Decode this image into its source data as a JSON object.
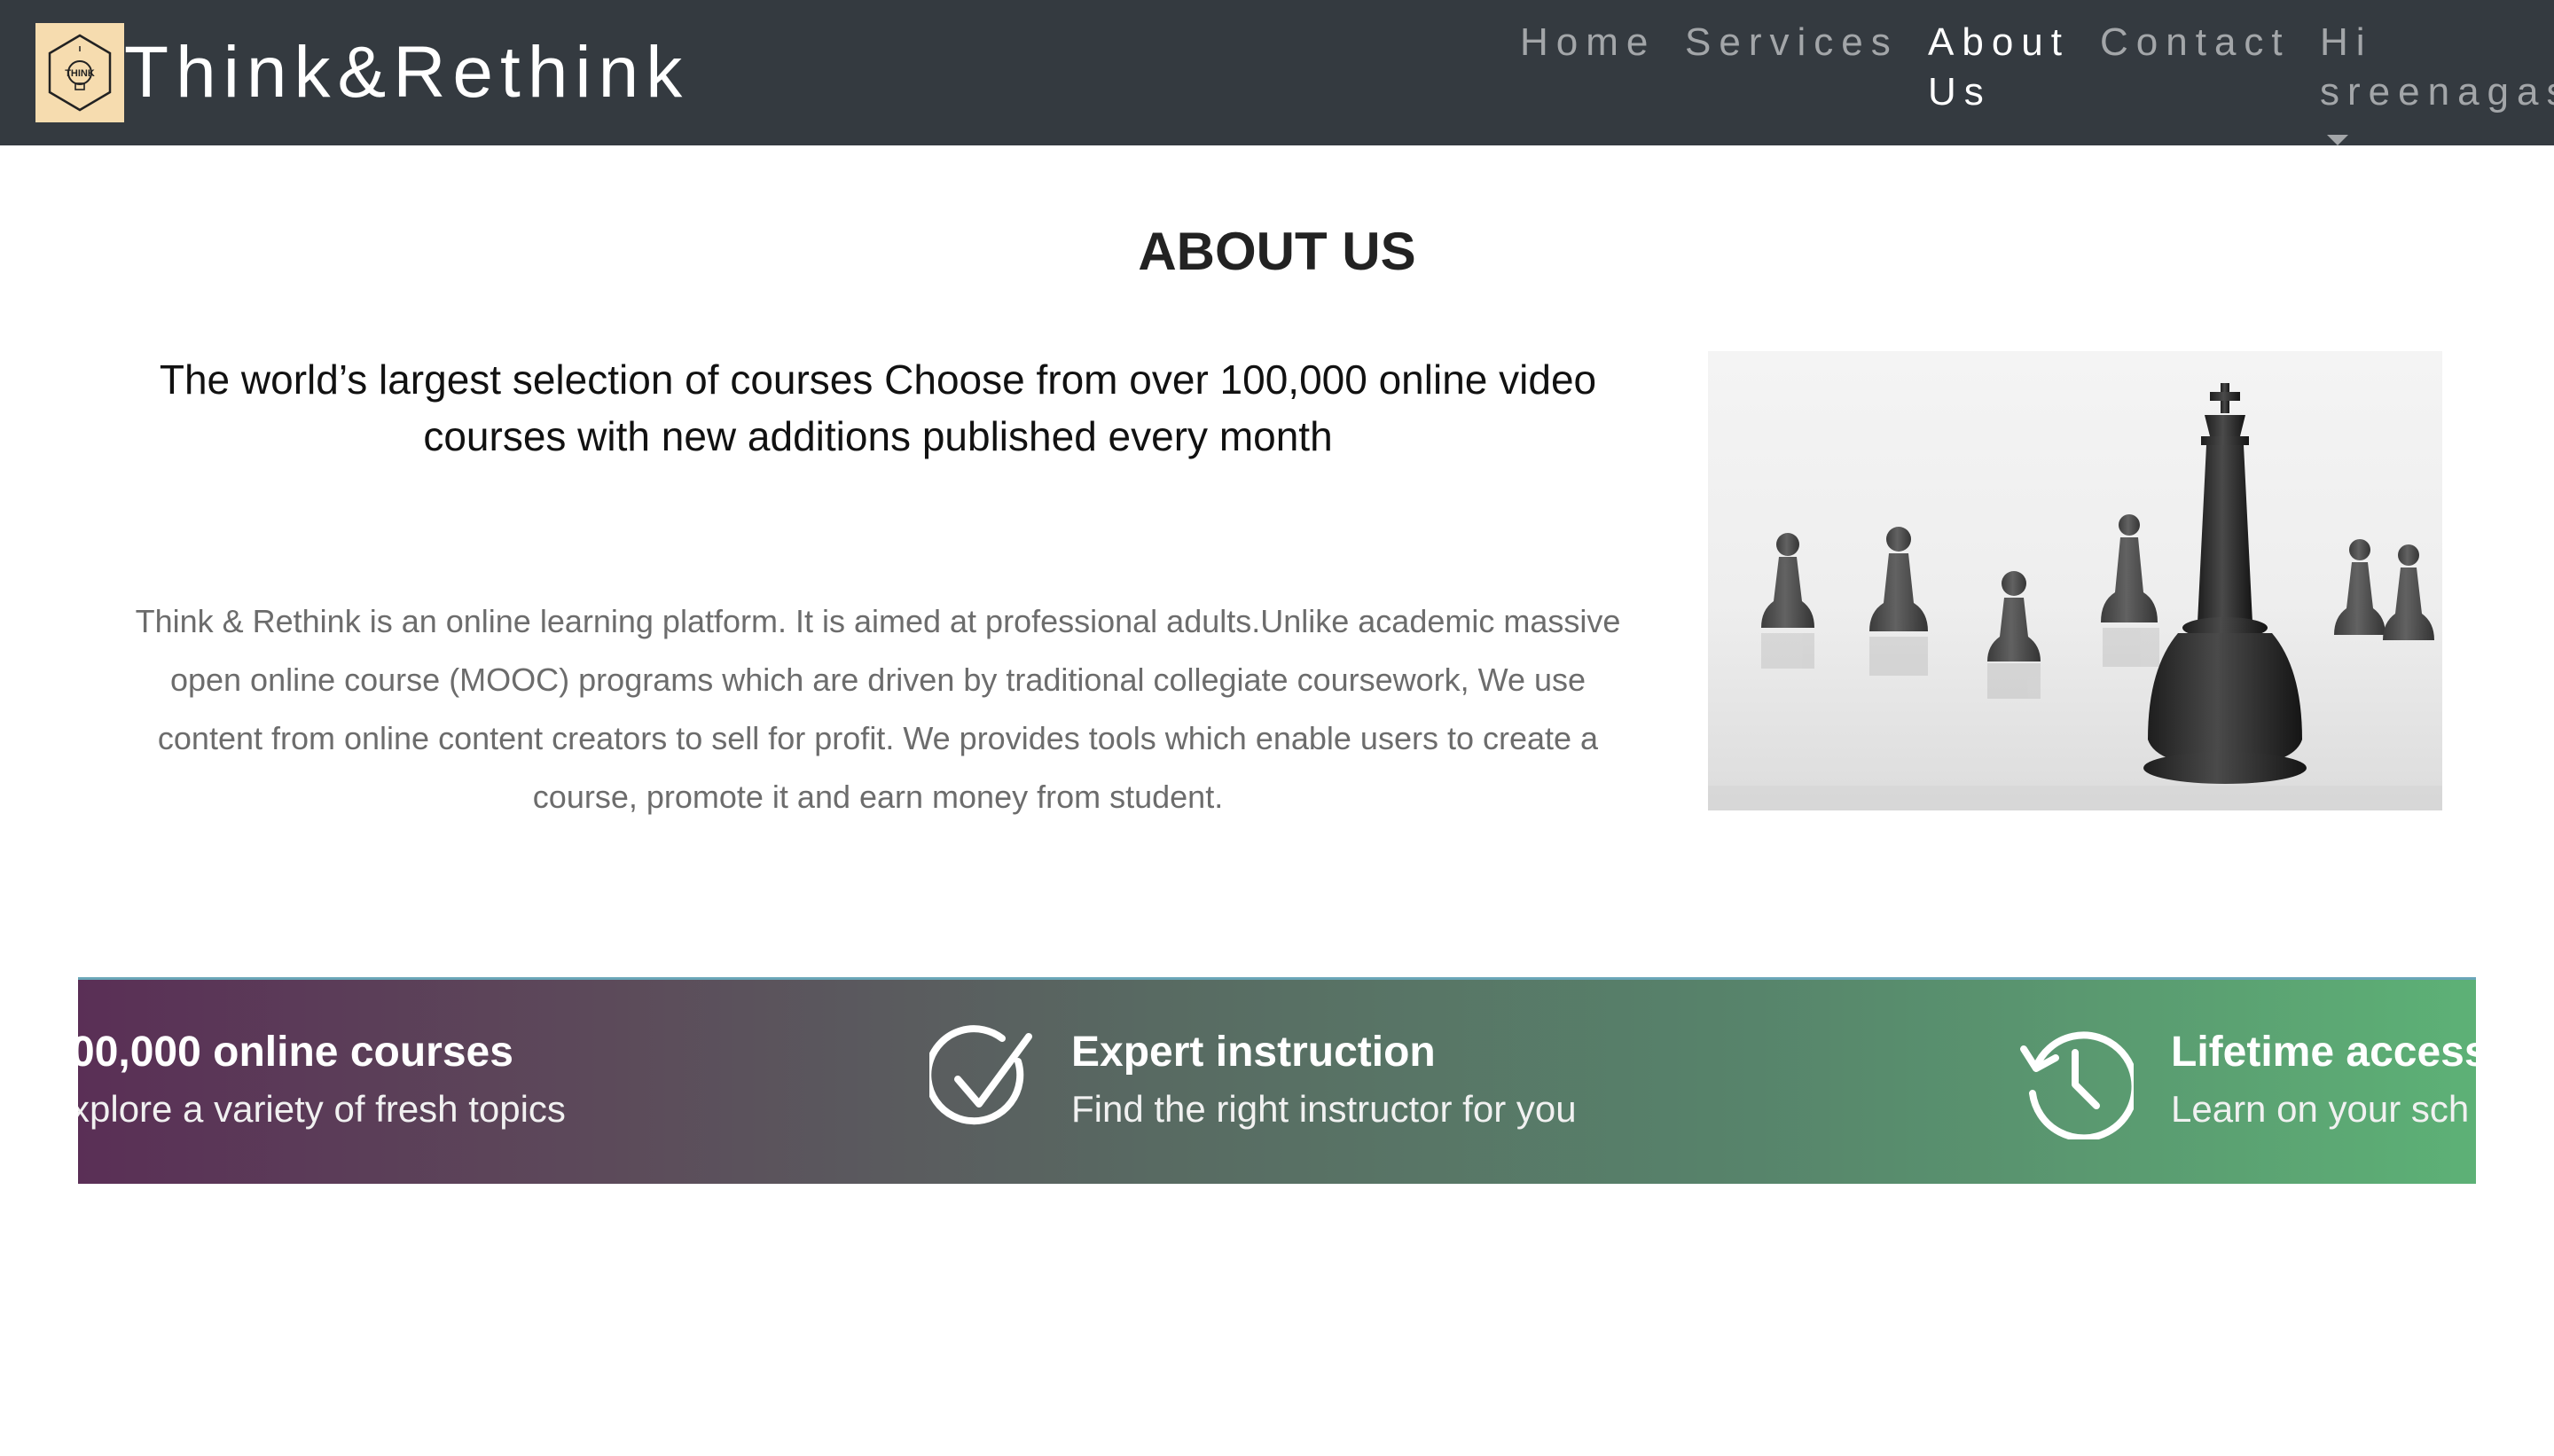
{
  "navbar": {
    "brand": "Think&Rethink",
    "logo_text": "THINK",
    "items": [
      {
        "label": "Home"
      },
      {
        "label": "Services"
      },
      {
        "label_line1": "About",
        "label_line2": "Us",
        "active": true
      },
      {
        "label": "Contact"
      },
      {
        "label_line1": "Hi",
        "label_line2": "sreenagas"
      }
    ],
    "bg_color": "#343a40"
  },
  "page": {
    "title": "ABOUT US",
    "lead": "The world’s largest selection of courses Choose from over 100,000 online video courses with new additions published every month",
    "description": "Think & Rethink is an online learning platform. It is aimed at professional adults.Unlike academic massive open online course (MOOC) programs which are driven by traditional collegiate coursework, We use content from online content creators to sell for profit. We provides tools which enable users to create a course, promote it and earn money from student."
  },
  "image": {
    "subject": "chess pieces",
    "icon": "chess-king-image"
  },
  "banner": {
    "features": [
      {
        "title": "00,000 online courses",
        "subtitle": "xplore a variety of fresh topics"
      },
      {
        "title": "Expert instruction",
        "subtitle": "Find the right instructor for you",
        "icon": "check-circle-icon"
      },
      {
        "title": "Lifetime access",
        "subtitle": "Learn on your sch",
        "icon": "history-clock-icon"
      }
    ]
  }
}
